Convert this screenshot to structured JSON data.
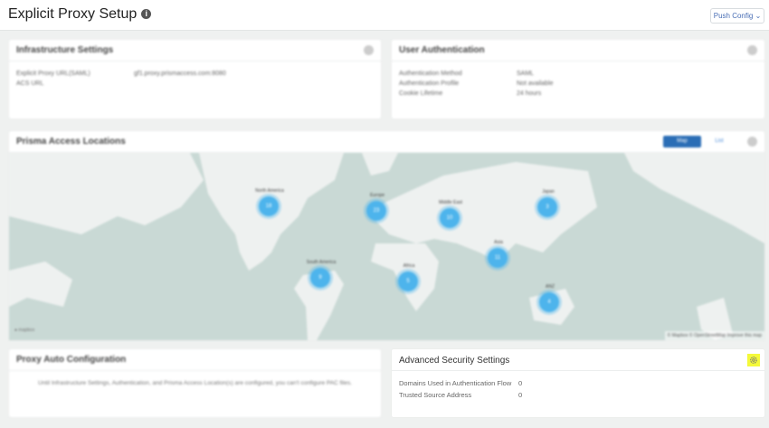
{
  "header": {
    "title": "Explicit Proxy Setup",
    "push_config": "Push Config"
  },
  "infrastructure": {
    "title": "Infrastructure Settings",
    "rows": [
      {
        "label": "Explicit Proxy URL(SAML)",
        "value": "gf1.proxy.prismaccess.com:8080"
      },
      {
        "label": "ACS URL",
        "value": ""
      }
    ]
  },
  "user_auth": {
    "title": "User Authentication",
    "rows": [
      {
        "label": "Authentication Method",
        "value": "SAML"
      },
      {
        "label": "Authentication Profile",
        "value": "Not available"
      },
      {
        "label": "Cookie Lifetime",
        "value": "24 hours"
      }
    ]
  },
  "locations": {
    "title": "Prisma Access Locations",
    "map_btn": "Map",
    "list_btn": "List",
    "attribution": "© Mapbox © OpenStreetMap Improve this map",
    "logo": "mapbox",
    "clusters": [
      {
        "label": "North America",
        "count": "18"
      },
      {
        "label": "Europe",
        "count": "23"
      },
      {
        "label": "Middle East",
        "count": "10"
      },
      {
        "label": "Japan",
        "count": "3"
      },
      {
        "label": "Asia",
        "count": "11"
      },
      {
        "label": "South America",
        "count": "9"
      },
      {
        "label": "Africa",
        "count": "5"
      },
      {
        "label": "ANZ",
        "count": "4"
      }
    ]
  },
  "pac": {
    "title": "Proxy Auto Configuration",
    "message": "Until Infrastructure Settings, Authentication, and Prisma Access Location(s) are configured, you can't configure PAC files."
  },
  "advanced": {
    "title": "Advanced Security Settings",
    "rows": [
      {
        "label": "Domains Used in Authentication Flow",
        "value": "0"
      },
      {
        "label": "Trusted Source Address",
        "value": "0"
      }
    ]
  }
}
